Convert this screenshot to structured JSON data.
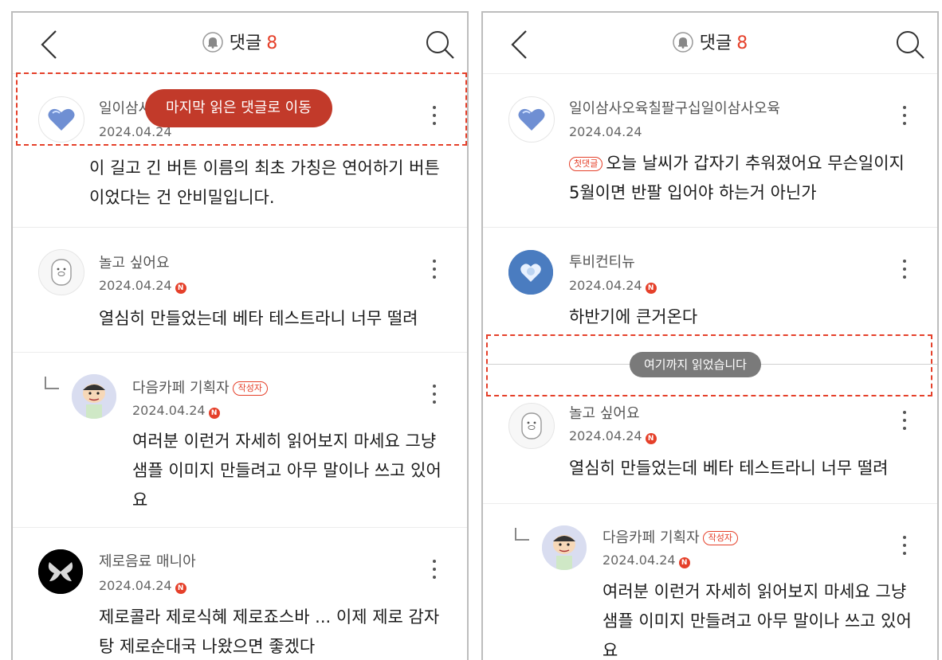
{
  "header": {
    "title": "댓글",
    "count": "8"
  },
  "left": {
    "jump_button": "마지막 읽은 댓글로 이동",
    "comments": [
      {
        "author": "일이삼사오육칠팔구십일이삼사오육",
        "author_visible": "일이삼사",
        "date": "2024.04.24",
        "body": "이 길고 긴 버튼 이름의 최초 가칭은 연어하기 버튼이었다는 건 안비밀입니다."
      },
      {
        "author": "놀고 싶어요",
        "date": "2024.04.24",
        "new_badge": "N",
        "body": "열심히 만들었는데 베타 테스트라니 너무 떨려"
      },
      {
        "author": "다음카페 기획자",
        "author_badge": "작성자",
        "date": "2024.04.24",
        "new_badge": "N",
        "body": "여러분 이런거 자세히 읽어보지 마세요 그냥 샘플 이미지 만들려고 아무 말이나 쓰고 있어요"
      },
      {
        "author": "제로음료 매니아",
        "date": "2024.04.24",
        "new_badge": "N",
        "body": "제로콜라 제로식혜 제로죠스바 ... 이제 제로 감자탕 제로순대국 나왔으면 좋겠다"
      }
    ]
  },
  "right": {
    "read_marker": "여기까지 읽었습니다",
    "comments": [
      {
        "author": "일이삼사오육칠팔구십일이삼사오육",
        "date": "2024.04.24",
        "first_badge": "첫댓글",
        "body": "오늘 날씨가 갑자기 추워졌어요 무슨일이지 5월이면 반팔 입어야 하는거 아닌가"
      },
      {
        "author": "투비컨티뉴",
        "date": "2024.04.24",
        "new_badge": "N",
        "body": "하반기에 큰거온다"
      },
      {
        "author": "놀고 싶어요",
        "date": "2024.04.24",
        "new_badge": "N",
        "body": "열심히 만들었는데 베타 테스트라니 너무 떨려"
      },
      {
        "author": "다음카페 기획자",
        "author_badge": "작성자",
        "date": "2024.04.24",
        "new_badge": "N",
        "body": "여러분 이런거 자세히 읽어보지 마세요 그냥 샘플 이미지 만들려고 아무 말이나 쓰고 있어요"
      }
    ]
  },
  "colors": {
    "accent": "#e5402a",
    "pill": "#c23a2a",
    "marker": "#7a7a7a",
    "divider": "#ececec"
  },
  "icons": [
    "back-icon",
    "bell-icon",
    "search-icon",
    "more-icon",
    "reply-icon"
  ]
}
